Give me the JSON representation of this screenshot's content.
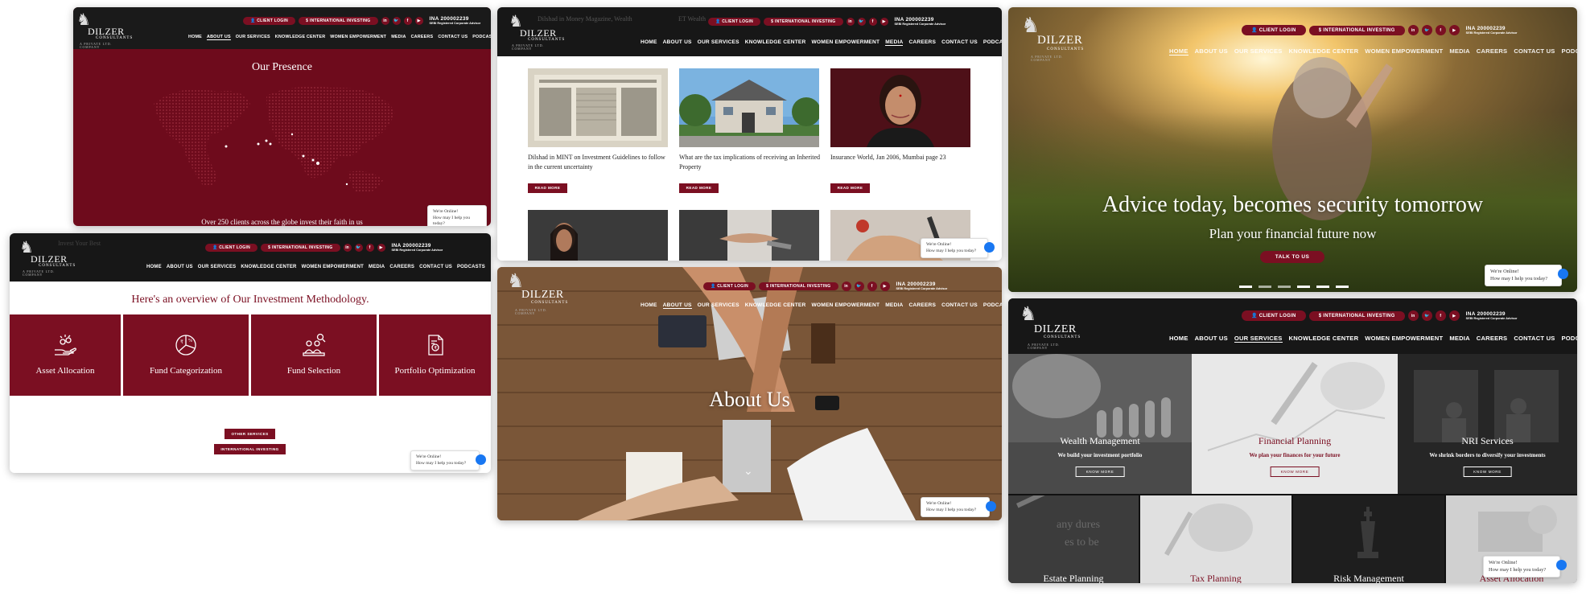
{
  "header": {
    "brand": "DILZER",
    "brand_sub": "CONSULTANTS",
    "brand_tag": "A PRIVATE LTD. COMPANY",
    "client_login": "CLIENT LOGIN",
    "international_investing": "INTERNATIONAL INVESTING",
    "social": [
      "in",
      "t",
      "f",
      "yt"
    ],
    "ina_number": "INA 200002239",
    "ina_sub": "SEBI Registered Corporate Advisor",
    "nav": [
      "HOME",
      "ABOUT US",
      "OUR SERVICES",
      "KNOWLEDGE CENTER",
      "WOMEN EMPOWERMENT",
      "MEDIA",
      "CAREERS",
      "CONTACT US",
      "PODCASTS"
    ]
  },
  "chat": {
    "line1": "We're Online!",
    "line2": "How may I help you today?"
  },
  "presence": {
    "title": "Our Presence",
    "caption": "Over 250 clients across the globe invest their faith in us"
  },
  "media": {
    "ghost_text_1": "Dilshad in Money Magazine, Wealth",
    "ghost_text_2": "ET Wealth",
    "articles": [
      {
        "title": "Dilshad in MINT on Investment Guidelines to follow in the current uncertainty",
        "button": "READ MORE"
      },
      {
        "title": "What are the tax implications of receiving an Inherited Property",
        "button": "READ MORE"
      },
      {
        "title": "Insurance World, Jan 2006, Mumbai page 23",
        "button": "READ MORE"
      }
    ]
  },
  "hero": {
    "headline": "Advice today, becomes security tomorrow",
    "subheadline": "Plan your financial future now",
    "cta": "TALK TO US"
  },
  "methodology": {
    "ghost_text": "Invest Your Best",
    "title": "Here's an overview of Our Investment Methodology.",
    "items": [
      "Asset Allocation",
      "Fund Categorization",
      "Fund Selection",
      "Portfolio Optimization"
    ],
    "btn_other": "OTHER SERVICES",
    "btn_intl": "INTERNATIONAL INVESTING"
  },
  "about": {
    "title": "About Us"
  },
  "services": {
    "tiles_top": [
      {
        "title": "Wealth Management",
        "subtitle": "We build your investment portfolio",
        "button": "KNOW MORE"
      },
      {
        "title": "Financial Planning",
        "subtitle": "We plan your finances for your future",
        "button": "KNOW MORE"
      },
      {
        "title": "NRI Services",
        "subtitle": "We shrink borders to diversify your investments",
        "button": "KNOW MORE"
      }
    ],
    "tiles_bottom": [
      "Estate Planning",
      "Tax Planning",
      "Risk Management",
      "Asset Allocation"
    ]
  },
  "colors": {
    "brand": "#7b0f22",
    "header": "#171717"
  }
}
